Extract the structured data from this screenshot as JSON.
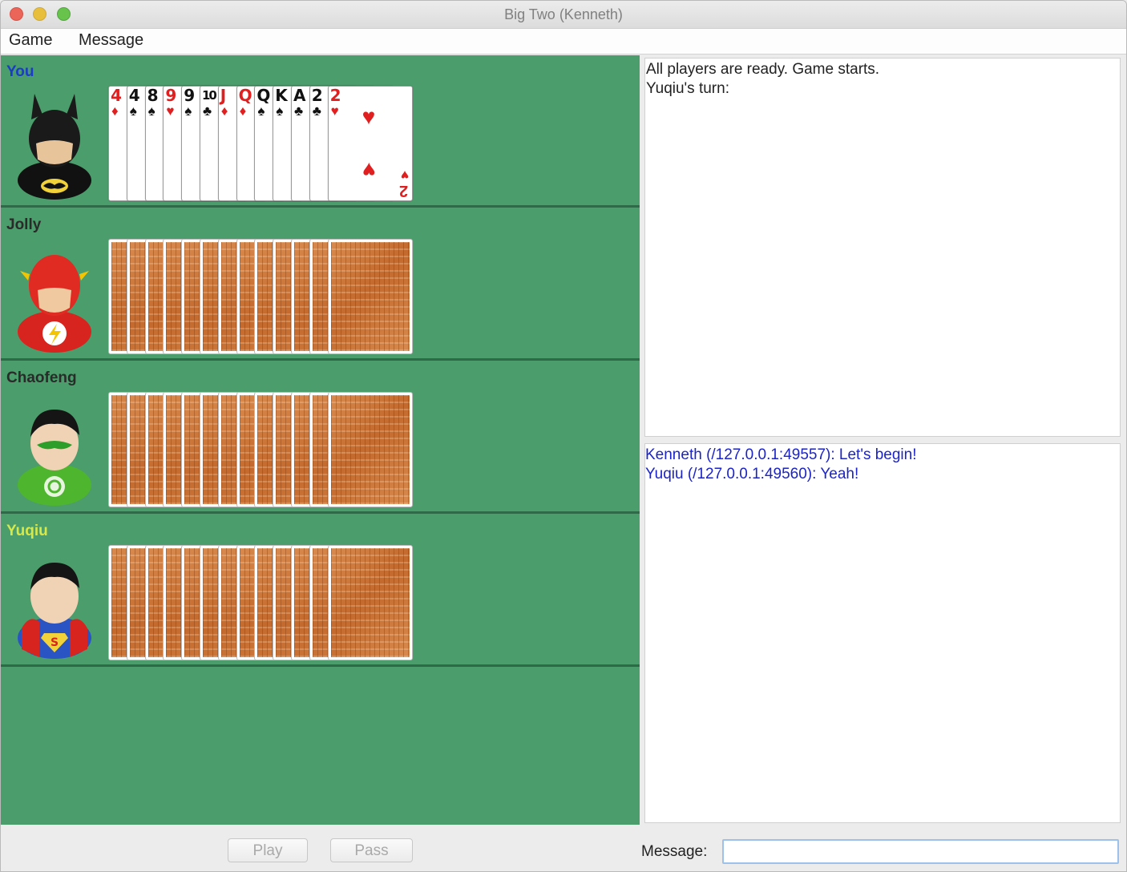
{
  "window": {
    "title": "Big Two (Kenneth)"
  },
  "menu": {
    "items": [
      "Game",
      "Message"
    ]
  },
  "players": [
    {
      "name": "You",
      "name_color": "#1a3cc8",
      "avatar": "batman-avatar",
      "face_up": true,
      "cards": [
        {
          "rank": "4",
          "suit": "♦",
          "color": "red"
        },
        {
          "rank": "4",
          "suit": "♠",
          "color": "black"
        },
        {
          "rank": "8",
          "suit": "♠",
          "color": "black"
        },
        {
          "rank": "9",
          "suit": "♥",
          "color": "red"
        },
        {
          "rank": "9",
          "suit": "♠",
          "color": "black"
        },
        {
          "rank": "10",
          "suit": "♣",
          "color": "black"
        },
        {
          "rank": "J",
          "suit": "♦",
          "color": "red"
        },
        {
          "rank": "Q",
          "suit": "♦",
          "color": "red"
        },
        {
          "rank": "Q",
          "suit": "♠",
          "color": "black"
        },
        {
          "rank": "K",
          "suit": "♠",
          "color": "black"
        },
        {
          "rank": "A",
          "suit": "♣",
          "color": "black"
        },
        {
          "rank": "2",
          "suit": "♣",
          "color": "black"
        },
        {
          "rank": "2",
          "suit": "♥",
          "color": "red"
        }
      ]
    },
    {
      "name": "Jolly",
      "name_color": "#2a2a2a",
      "avatar": "flash-avatar",
      "face_up": false,
      "card_count": 13
    },
    {
      "name": "Chaofeng",
      "name_color": "#2a2a2a",
      "avatar": "green-lantern-avatar",
      "face_up": false,
      "card_count": 13
    },
    {
      "name": "Yuqiu",
      "name_color": "#d7e84a",
      "avatar": "superman-avatar",
      "face_up": false,
      "card_count": 13
    }
  ],
  "game_log": [
    "All players are ready. Game starts.",
    "Yuqiu's turn:"
  ],
  "chat_log": [
    "Kenneth (/127.0.0.1:49557): Let's begin!",
    "Yuqiu (/127.0.0.1:49560): Yeah!"
  ],
  "controls": {
    "play_label": "Play",
    "pass_label": "Pass",
    "message_label": "Message:",
    "message_value": ""
  }
}
